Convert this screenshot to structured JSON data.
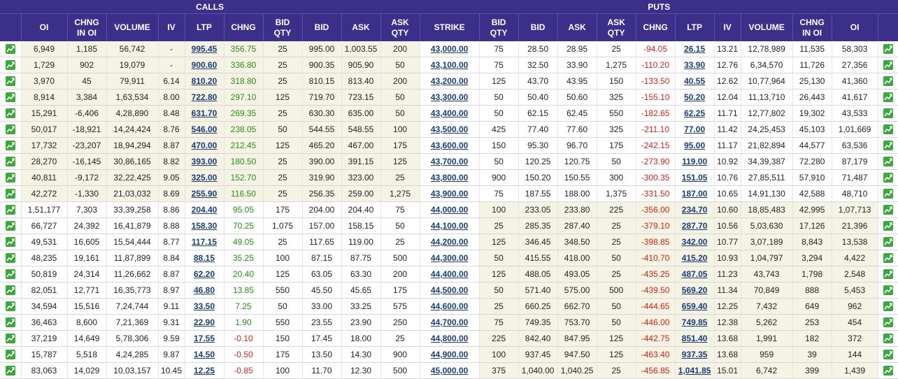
{
  "headers": {
    "calls": "CALLS",
    "puts": "PUTS",
    "columns": [
      "OI",
      "CHNG\nIN OI",
      "VOLUME",
      "IV",
      "LTP",
      "CHNG",
      "BID\nQTY",
      "BID",
      "ASK",
      "ASK\nQTY",
      "STRIKE",
      "BID\nQTY",
      "BID",
      "ASK",
      "ASK\nQTY",
      "CHNG",
      "LTP",
      "IV",
      "VOLUME",
      "CHNG\nIN OI",
      "OI"
    ]
  },
  "icons": {
    "row_chart": "line-chart-icon"
  },
  "colors": {
    "header_bg": "#3b2f8a",
    "itm_bg": "#f5f3e3",
    "positive": "#2a8a1c",
    "negative": "#d0231e",
    "link": "#1a3b7a"
  },
  "rows": [
    {
      "c": [
        "6,949",
        "1,185",
        "56,742",
        "-",
        "995.45",
        "356.75",
        "25",
        "995.00",
        "1,003.55",
        "200"
      ],
      "strike": "43,000.00",
      "p": [
        "75",
        "28.50",
        "28.95",
        "25",
        "-94.05",
        "26.15",
        "13.21",
        "12,78,989",
        "11,535",
        "58,303"
      ]
    },
    {
      "c": [
        "1,729",
        "902",
        "19,079",
        "-",
        "900.60",
        "336.80",
        "25",
        "900.35",
        "905.90",
        "50"
      ],
      "strike": "43,100.00",
      "p": [
        "75",
        "32.50",
        "33.90",
        "1,275",
        "-110.20",
        "33.90",
        "12.76",
        "6,34,570",
        "11,726",
        "27,356"
      ]
    },
    {
      "c": [
        "3,970",
        "45",
        "79,911",
        "6.14",
        "810.20",
        "318.80",
        "25",
        "810.15",
        "813.40",
        "200"
      ],
      "strike": "43,200.00",
      "p": [
        "125",
        "43.70",
        "43.95",
        "150",
        "-133.50",
        "40.55",
        "12.62",
        "10,77,964",
        "25,130",
        "41,360"
      ]
    },
    {
      "c": [
        "8,914",
        "3,384",
        "1,63,534",
        "8.00",
        "722.80",
        "297.10",
        "125",
        "719.70",
        "723.15",
        "50"
      ],
      "strike": "43,300.00",
      "p": [
        "50",
        "50.40",
        "50.60",
        "325",
        "-155.10",
        "50.20",
        "12.04",
        "11,13,710",
        "26,443",
        "41,617"
      ]
    },
    {
      "c": [
        "15,291",
        "-6,406",
        "4,28,890",
        "8.48",
        "631.70",
        "269.35",
        "25",
        "630.30",
        "635.00",
        "50"
      ],
      "strike": "43,400.00",
      "p": [
        "50",
        "62.15",
        "62.45",
        "550",
        "-182.65",
        "62.25",
        "11.71",
        "12,77,802",
        "19,302",
        "43,533"
      ]
    },
    {
      "c": [
        "50,017",
        "-18,921",
        "14,24,424",
        "8.76",
        "546.00",
        "238.05",
        "50",
        "544.55",
        "548.55",
        "100"
      ],
      "strike": "43,500.00",
      "p": [
        "425",
        "77.40",
        "77.60",
        "325",
        "-211.10",
        "77.00",
        "11.42",
        "24,25,453",
        "45,103",
        "1,01,669"
      ]
    },
    {
      "c": [
        "17,732",
        "-23,207",
        "18,94,294",
        "8.87",
        "470.00",
        "212.45",
        "125",
        "465.20",
        "467.00",
        "175"
      ],
      "strike": "43,600.00",
      "p": [
        "150",
        "95.30",
        "96.70",
        "175",
        "-242.15",
        "95.00",
        "11.17",
        "21,82,894",
        "44,577",
        "63,536"
      ]
    },
    {
      "c": [
        "28,270",
        "-16,145",
        "30,86,165",
        "8.82",
        "393.00",
        "180.50",
        "25",
        "390.00",
        "391.15",
        "125"
      ],
      "strike": "43,700.00",
      "p": [
        "50",
        "120.25",
        "120.75",
        "50",
        "-273.90",
        "119.00",
        "10.92",
        "34,39,387",
        "72,280",
        "87,179"
      ]
    },
    {
      "c": [
        "40,811",
        "-9,172",
        "32,22,425",
        "9.05",
        "325.00",
        "152.70",
        "25",
        "319.90",
        "323.00",
        "25"
      ],
      "strike": "43,800.00",
      "p": [
        "900",
        "150.20",
        "150.55",
        "300",
        "-300.35",
        "151.05",
        "10.76",
        "27,85,511",
        "57,910",
        "71,487"
      ]
    },
    {
      "c": [
        "42,272",
        "-1,330",
        "21,03,032",
        "8.69",
        "255.90",
        "116.50",
        "25",
        "256.35",
        "259.00",
        "1,275"
      ],
      "strike": "43,900.00",
      "p": [
        "75",
        "187.55",
        "188.00",
        "1,375",
        "-331.50",
        "187.00",
        "10.65",
        "14,91,130",
        "42,588",
        "48,710"
      ]
    },
    {
      "c": [
        "1,51,177",
        "7,303",
        "33,39,258",
        "8.86",
        "204.40",
        "95.05",
        "175",
        "204.00",
        "204.40",
        "75"
      ],
      "strike": "44,000.00",
      "p": [
        "100",
        "233.05",
        "233.80",
        "225",
        "-356.00",
        "234.70",
        "10.60",
        "18,85,483",
        "42,995",
        "1,07,713"
      ]
    },
    {
      "c": [
        "66,727",
        "24,392",
        "16,41,879",
        "8.88",
        "158.30",
        "70.25",
        "1,075",
        "157.00",
        "158.15",
        "50"
      ],
      "strike": "44,100.00",
      "p": [
        "25",
        "285.35",
        "287.40",
        "25",
        "-379.10",
        "287.70",
        "10.56",
        "5,03,630",
        "17,126",
        "21,396"
      ]
    },
    {
      "c": [
        "49,531",
        "16,605",
        "15,54,444",
        "8.77",
        "117.15",
        "49.05",
        "25",
        "117.65",
        "119.00",
        "25"
      ],
      "strike": "44,200.00",
      "p": [
        "125",
        "346.45",
        "348.50",
        "25",
        "-398.85",
        "342.00",
        "10.77",
        "3,07,189",
        "8,843",
        "13,538"
      ]
    },
    {
      "c": [
        "48,235",
        "19,161",
        "11,87,899",
        "8.84",
        "88.15",
        "35.25",
        "100",
        "87.15",
        "87.75",
        "500"
      ],
      "strike": "44,300.00",
      "p": [
        "50",
        "415.55",
        "418.00",
        "50",
        "-410.70",
        "415.20",
        "10.93",
        "1,04,797",
        "3,294",
        "4,422"
      ]
    },
    {
      "c": [
        "50,819",
        "24,314",
        "11,26,662",
        "8.87",
        "62.20",
        "20.40",
        "125",
        "63.05",
        "63.30",
        "200"
      ],
      "strike": "44,400.00",
      "p": [
        "125",
        "488.05",
        "493.05",
        "25",
        "-435.25",
        "487.05",
        "11.23",
        "43,743",
        "1,798",
        "2,548"
      ]
    },
    {
      "c": [
        "82,051",
        "12,771",
        "16,35,773",
        "8.97",
        "46.80",
        "13.85",
        "550",
        "45.50",
        "45.65",
        "175"
      ],
      "strike": "44,500.00",
      "p": [
        "50",
        "571.40",
        "575.00",
        "500",
        "-439.50",
        "569.20",
        "11.34",
        "70,849",
        "888",
        "5,453"
      ]
    },
    {
      "c": [
        "34,594",
        "15,516",
        "7,24,744",
        "9.11",
        "33.50",
        "7.25",
        "50",
        "33.00",
        "33.25",
        "575"
      ],
      "strike": "44,600.00",
      "p": [
        "25",
        "660.25",
        "662.70",
        "50",
        "-444.65",
        "659.40",
        "12.25",
        "7,432",
        "649",
        "962"
      ]
    },
    {
      "c": [
        "36,463",
        "8,600",
        "7,21,369",
        "9.31",
        "22.90",
        "1.90",
        "550",
        "23.55",
        "23.90",
        "250"
      ],
      "strike": "44,700.00",
      "p": [
        "75",
        "749.35",
        "753.70",
        "50",
        "-446.00",
        "749.85",
        "12.38",
        "5,262",
        "253",
        "454"
      ]
    },
    {
      "c": [
        "37,219",
        "14,649",
        "5,78,306",
        "9.59",
        "17.55",
        "-0.10",
        "150",
        "17.45",
        "18.00",
        "25"
      ],
      "strike": "44,800.00",
      "p": [
        "225",
        "842.40",
        "847.95",
        "125",
        "-442.75",
        "851.40",
        "13.68",
        "1,991",
        "182",
        "372"
      ]
    },
    {
      "c": [
        "15,787",
        "5,518",
        "4,24,285",
        "9.87",
        "14.50",
        "-0.50",
        "175",
        "13.50",
        "14.30",
        "900"
      ],
      "strike": "44,900.00",
      "p": [
        "100",
        "937.45",
        "947.50",
        "125",
        "-463.40",
        "937.35",
        "13.68",
        "959",
        "39",
        "144"
      ]
    },
    {
      "c": [
        "83,063",
        "14,029",
        "10,03,157",
        "10.45",
        "12.25",
        "-0.85",
        "100",
        "11.70",
        "12.30",
        "500"
      ],
      "strike": "45,000.00",
      "p": [
        "375",
        "1,040.00",
        "1,040.25",
        "25",
        "-456.85",
        "1,041.85",
        "15.01",
        "6,742",
        "399",
        "1,439"
      ]
    }
  ]
}
